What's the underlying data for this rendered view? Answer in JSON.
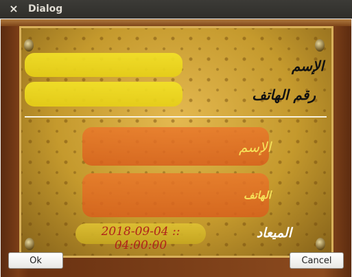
{
  "window": {
    "title": "Dialog",
    "close_glyph": "×"
  },
  "form": {
    "name_label": "الإسم",
    "phone_label": "رقم الهاتف",
    "display_name_label": "الإسم",
    "display_phone_label": "الهاتف",
    "appointment_label": "الميعاد",
    "datetime_value": "2018-09-04 :: 04:00:00"
  },
  "buttons": {
    "ok": "Ok",
    "cancel": "Cancel"
  },
  "colors": {
    "label_black": "#111111",
    "label_yellow": "#f6e25a",
    "label_white": "#ffffff",
    "datetime_text": "#b0231a",
    "field_yellow": "#f0dc22",
    "field_orange": "#e46b24"
  }
}
